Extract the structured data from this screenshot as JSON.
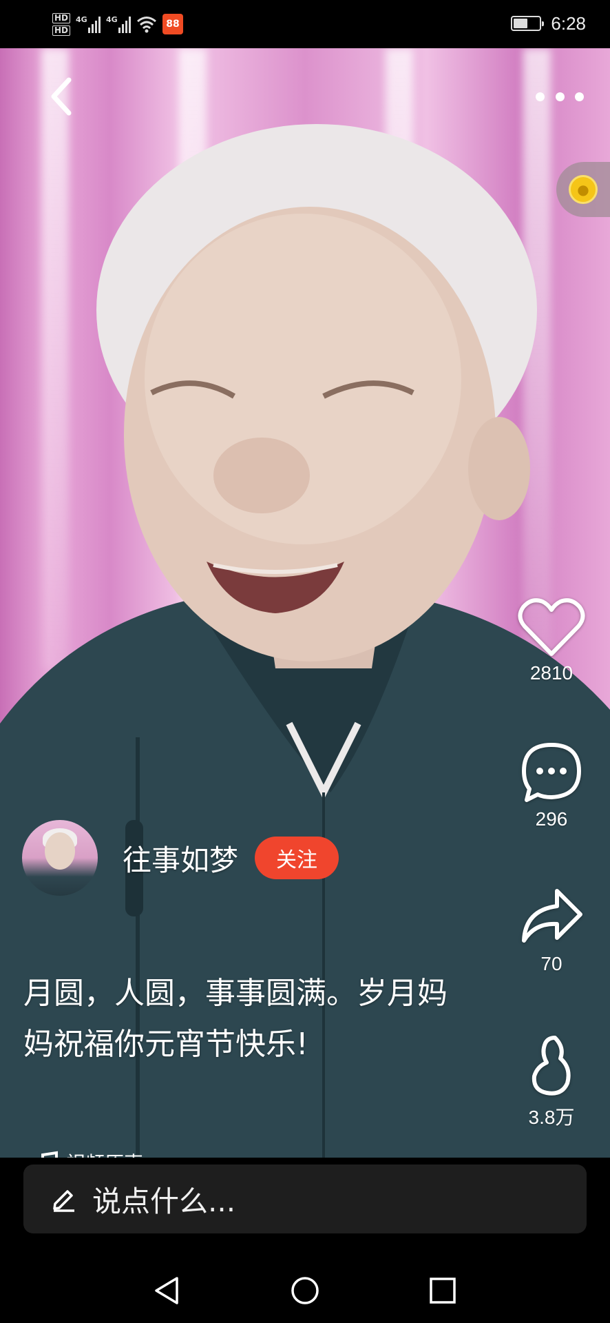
{
  "status_bar": {
    "sim1": "HD",
    "sim2": "HD",
    "network1": "4G",
    "network2": "4G",
    "app_badge": "88",
    "battery_level": 0.55,
    "time": "6:28"
  },
  "author": {
    "name": "往事如梦",
    "follow_label": "关注"
  },
  "caption": {
    "text": "月圆，人圆，事事圆满。岁月妈妈祝福你元宵节快乐!"
  },
  "music": {
    "label": "视频原声"
  },
  "actions": {
    "likes": "2810",
    "comments": "296",
    "shares": "70",
    "collects": "3.8万"
  },
  "comment_box": {
    "placeholder": "说点什么..."
  },
  "colors": {
    "follow_button": "#f0452d",
    "coin": "#f5c518",
    "comment_bar": "#1e1e1e"
  },
  "icons": [
    "back-arrow-icon",
    "more-dots-icon",
    "coin-icon",
    "heart-icon",
    "comment-icon",
    "share-icon",
    "collect-icon",
    "music-note-icon",
    "pencil-icon",
    "nav-back-icon",
    "nav-home-icon",
    "nav-recents-icon"
  ]
}
